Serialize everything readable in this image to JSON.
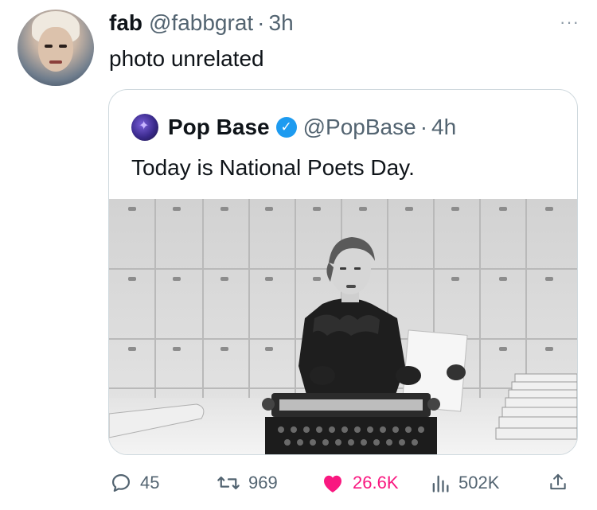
{
  "tweet": {
    "author_name": "fab",
    "author_handle": "@fabbgrat",
    "dot": "·",
    "time": "3h",
    "text": "photo unrelated",
    "more_glyph": "···"
  },
  "quote": {
    "author_name": "Pop Base",
    "author_handle": "@PopBase",
    "dot": "·",
    "time": "4h",
    "text": "Today is National Poets Day.",
    "verified_glyph": "✓"
  },
  "actions": {
    "replies": "45",
    "retweets": "969",
    "likes": "26.6K",
    "views": "502K"
  },
  "colors": {
    "secondary_text": "#536471",
    "like_pink": "#f91880",
    "verified_blue": "#1d9bf0",
    "border": "#cfd9de"
  },
  "icons": {
    "more": "more-horizontal-icon",
    "reply": "reply-icon",
    "retweet": "retweet-icon",
    "like": "heart-icon",
    "views": "analytics-icon",
    "share": "share-icon",
    "verified": "verified-badge-icon"
  }
}
